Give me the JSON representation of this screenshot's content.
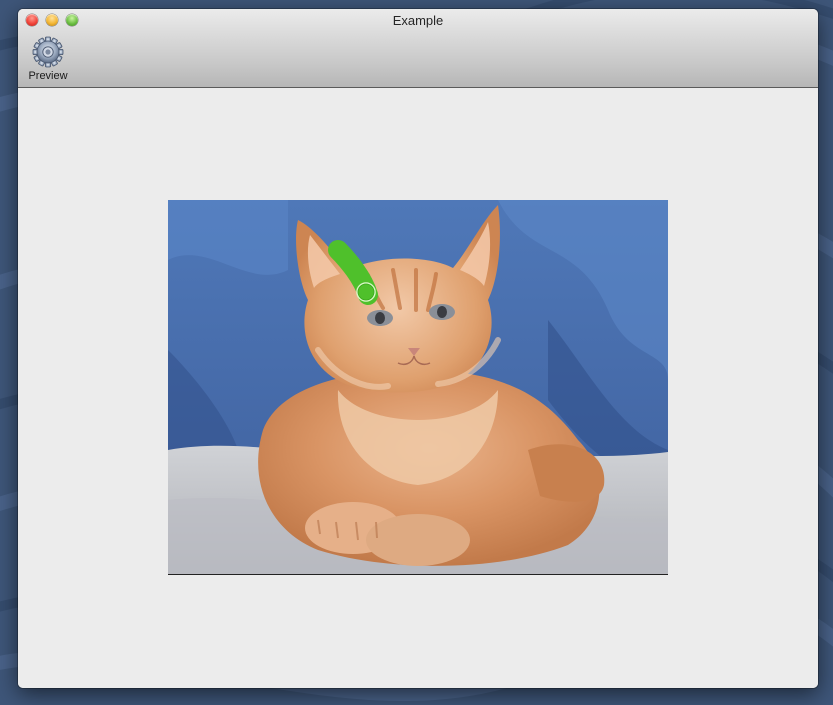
{
  "window": {
    "title": "Example"
  },
  "toolbar": {
    "items": [
      {
        "label": "Preview",
        "icon": "gear-icon"
      }
    ]
  },
  "canvas": {
    "image": "kitten-photo",
    "brush_color": "#4fc02b",
    "cursor_color": "#7fe05a"
  },
  "colors": {
    "desktop_background": "#3d5478",
    "window_background": "#ececec",
    "close_button": "#f2453b",
    "minimize_button": "#f3b634",
    "zoom_button": "#6dc043"
  }
}
